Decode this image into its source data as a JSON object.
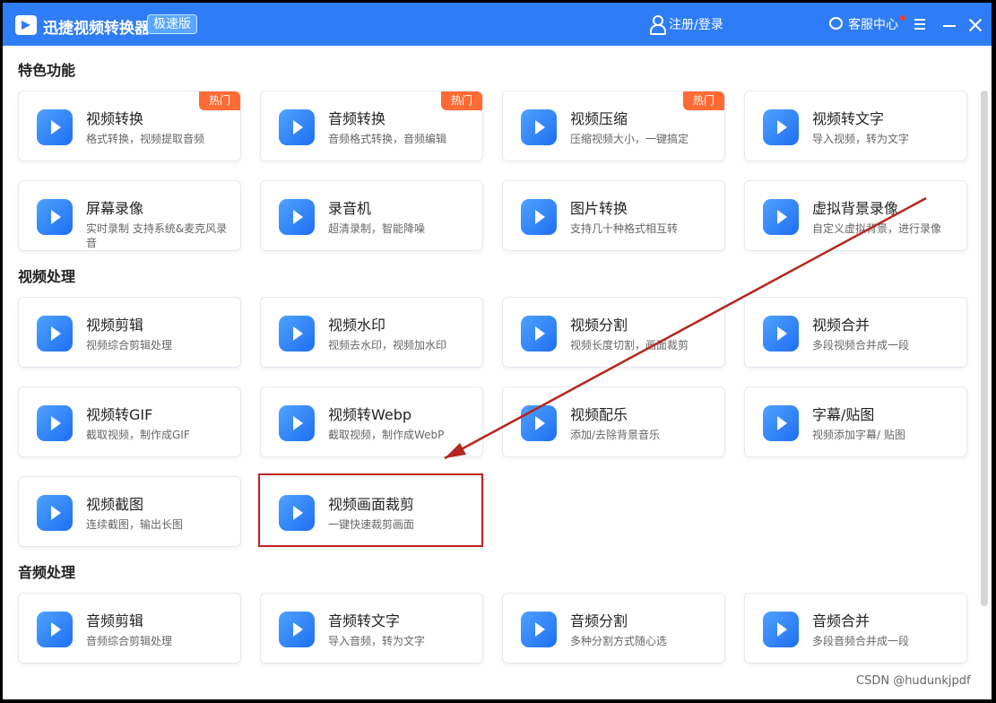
{
  "app": {
    "title": "迅捷视频转换器",
    "edition": "极速版"
  },
  "header": {
    "login": "注册/登录",
    "support": "客服中心"
  },
  "sections": [
    {
      "title": "特色功能",
      "cards": [
        {
          "title": "视频转换",
          "desc": "格式转换，视频提取音频",
          "hot": "热门"
        },
        {
          "title": "音频转换",
          "desc": "音频格式转换，音频编辑",
          "hot": "热门"
        },
        {
          "title": "视频压缩",
          "desc": "压缩视频大小，一键搞定",
          "hot": "热门"
        },
        {
          "title": "视频转文字",
          "desc": "导入视频，转为文字"
        },
        {
          "title": "屏幕录像",
          "desc": "实时录制 支持系统&麦克风录音"
        },
        {
          "title": "录音机",
          "desc": "超清录制，智能降噪"
        },
        {
          "title": "图片转换",
          "desc": "支持几十种格式相互转"
        },
        {
          "title": "虚拟背景录像",
          "desc": "自定义虚拟背景，进行录像"
        }
      ]
    },
    {
      "title": "视频处理",
      "cards": [
        {
          "title": "视频剪辑",
          "desc": "视频综合剪辑处理"
        },
        {
          "title": "视频水印",
          "desc": "视频去水印，视频加水印"
        },
        {
          "title": "视频分割",
          "desc": "视频长度切割，画面裁剪"
        },
        {
          "title": "视频合并",
          "desc": "多段视频合并成一段"
        },
        {
          "title": "视频转GIF",
          "desc": "截取视频，制作成GIF"
        },
        {
          "title": "视频转Webp",
          "desc": "截取视频，制作成WebP"
        },
        {
          "title": "视频配乐",
          "desc": "添加/去除背景音乐"
        },
        {
          "title": "字幕/贴图",
          "desc": "视频添加字幕/ 贴图"
        },
        {
          "title": "视频截图",
          "desc": "连续截图，输出长图"
        },
        {
          "title": "视频画面裁剪",
          "desc": "一键快速裁剪画面"
        }
      ]
    },
    {
      "title": "音频处理",
      "cards": [
        {
          "title": "音频剪辑",
          "desc": "音频综合剪辑处理"
        },
        {
          "title": "音频转文字",
          "desc": "导入音频，转为文字"
        },
        {
          "title": "音频分割",
          "desc": "多种分割方式随心选"
        },
        {
          "title": "音频合并",
          "desc": "多段音频合并成一段"
        }
      ]
    }
  ],
  "watermark": "CSDN @hudunkjpdf"
}
